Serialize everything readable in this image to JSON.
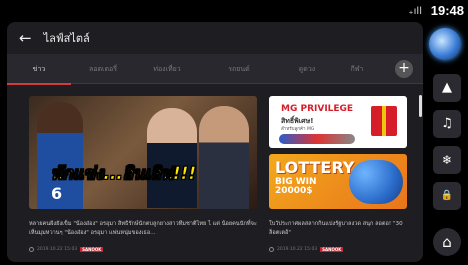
{
  "status": {
    "time": "19:48",
    "signal": "₊ıll"
  },
  "header": {
    "title": "ไลฟ์สไตล์",
    "back_glyph": "←"
  },
  "tabs": [
    {
      "label": "ข่าว",
      "active": true
    },
    {
      "label": "ลอตเตอรี่"
    },
    {
      "label": "ท่องเที่ยว"
    },
    {
      "label": "รถยนต์"
    },
    {
      "label": "ดูดวง"
    },
    {
      "label": "กีฬา"
    }
  ],
  "add_button": "+",
  "articles": [
    {
      "headline_overlay": "พักแข่ง...อินเลิฟ!!!",
      "jersey_number": "6",
      "caption": "หลายคนฝังยังเข็ม \"น้องอ๋อง\" อรอุมา สิทธิรักษ์นักตบลูกยางสาวทีมชาติไทย ไ แต่ น้อยคนนักที่จะเห็นมุมหวานๆ \"น้องอ๋อง\" อรอุมา แฟนหนุ่มของเธอ...",
      "date": "2019.10.22 15:03",
      "source": "SANOOK"
    },
    {
      "brand": "MG PRIVILEGE",
      "promo_line": "สิทธิ์พิเศษ!",
      "promo_small": "สำหรับลูกค้า MG"
    },
    {
      "title": "LOTTERY",
      "sub": "BIG WIN",
      "amount": "20000$",
      "caption": "ใบวัประกาศผลสลากกินแบ่งรัฐบาลงวด สนุก ลอตอ! \"30 ล็อตเตอ้\"",
      "date": "2019.10.22 15:03",
      "source": "SANOOK"
    }
  ],
  "side_buttons": [
    {
      "name": "navigation-arrow-icon",
      "glyph": "▲"
    },
    {
      "name": "music-note-icon",
      "glyph": "♫"
    },
    {
      "name": "climate-fan-icon",
      "glyph": "❄"
    },
    {
      "name": "lock-icon",
      "glyph": "🔒"
    },
    {
      "name": "home-icon",
      "glyph": "⌂"
    }
  ],
  "colors": {
    "accent": "#d63b3b",
    "frame": "#1d1d22",
    "tab_bar": "#28282e"
  }
}
